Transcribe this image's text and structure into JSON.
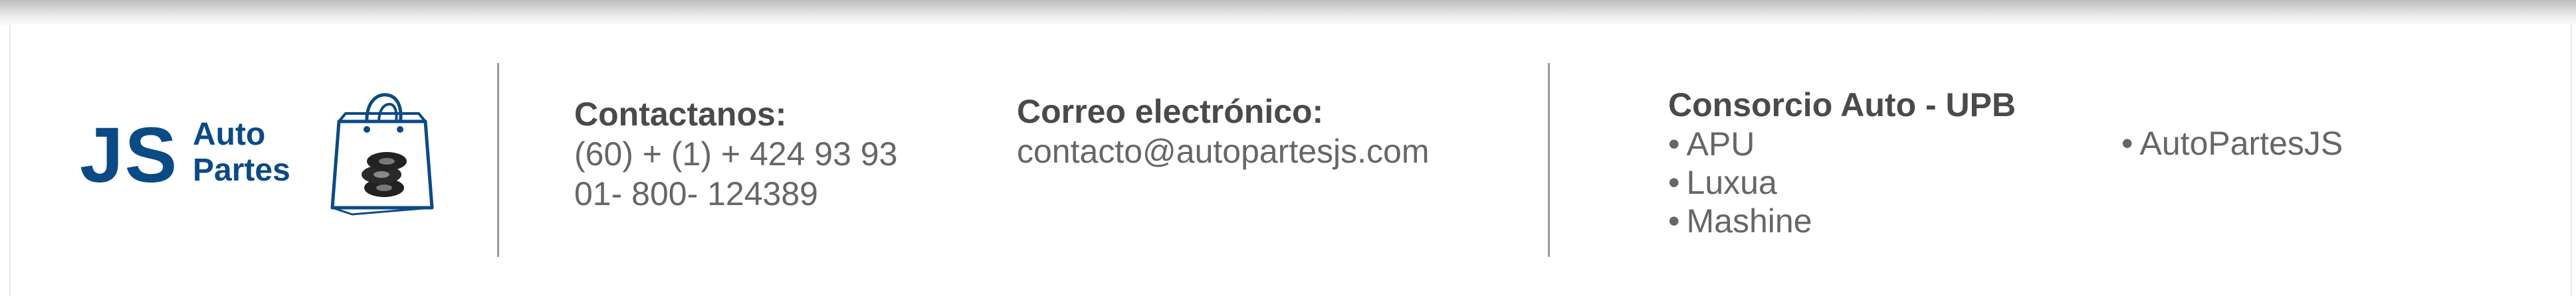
{
  "logo": {
    "initials": "JS",
    "line1": "Auto",
    "line2": "Partes",
    "brand_color": "#0b4a85",
    "icon": "shopping-bag-tires-icon"
  },
  "contact": {
    "title": "Contactanos:",
    "phone1": "(60) + (1) + 424 93 93",
    "phone2": "01- 800- 124389"
  },
  "email": {
    "title": "Correo electrónico:",
    "address": "contacto@autopartesjs.com"
  },
  "consorcio": {
    "title": "Consorcio Auto - UPB",
    "bullet": "•",
    "items": [
      "APU",
      "Luxua",
      "Mashine",
      "AutoPartesJS"
    ]
  },
  "colors": {
    "text": "#666666",
    "heading": "#4a4a4a",
    "divider": "#9a9a9a"
  }
}
